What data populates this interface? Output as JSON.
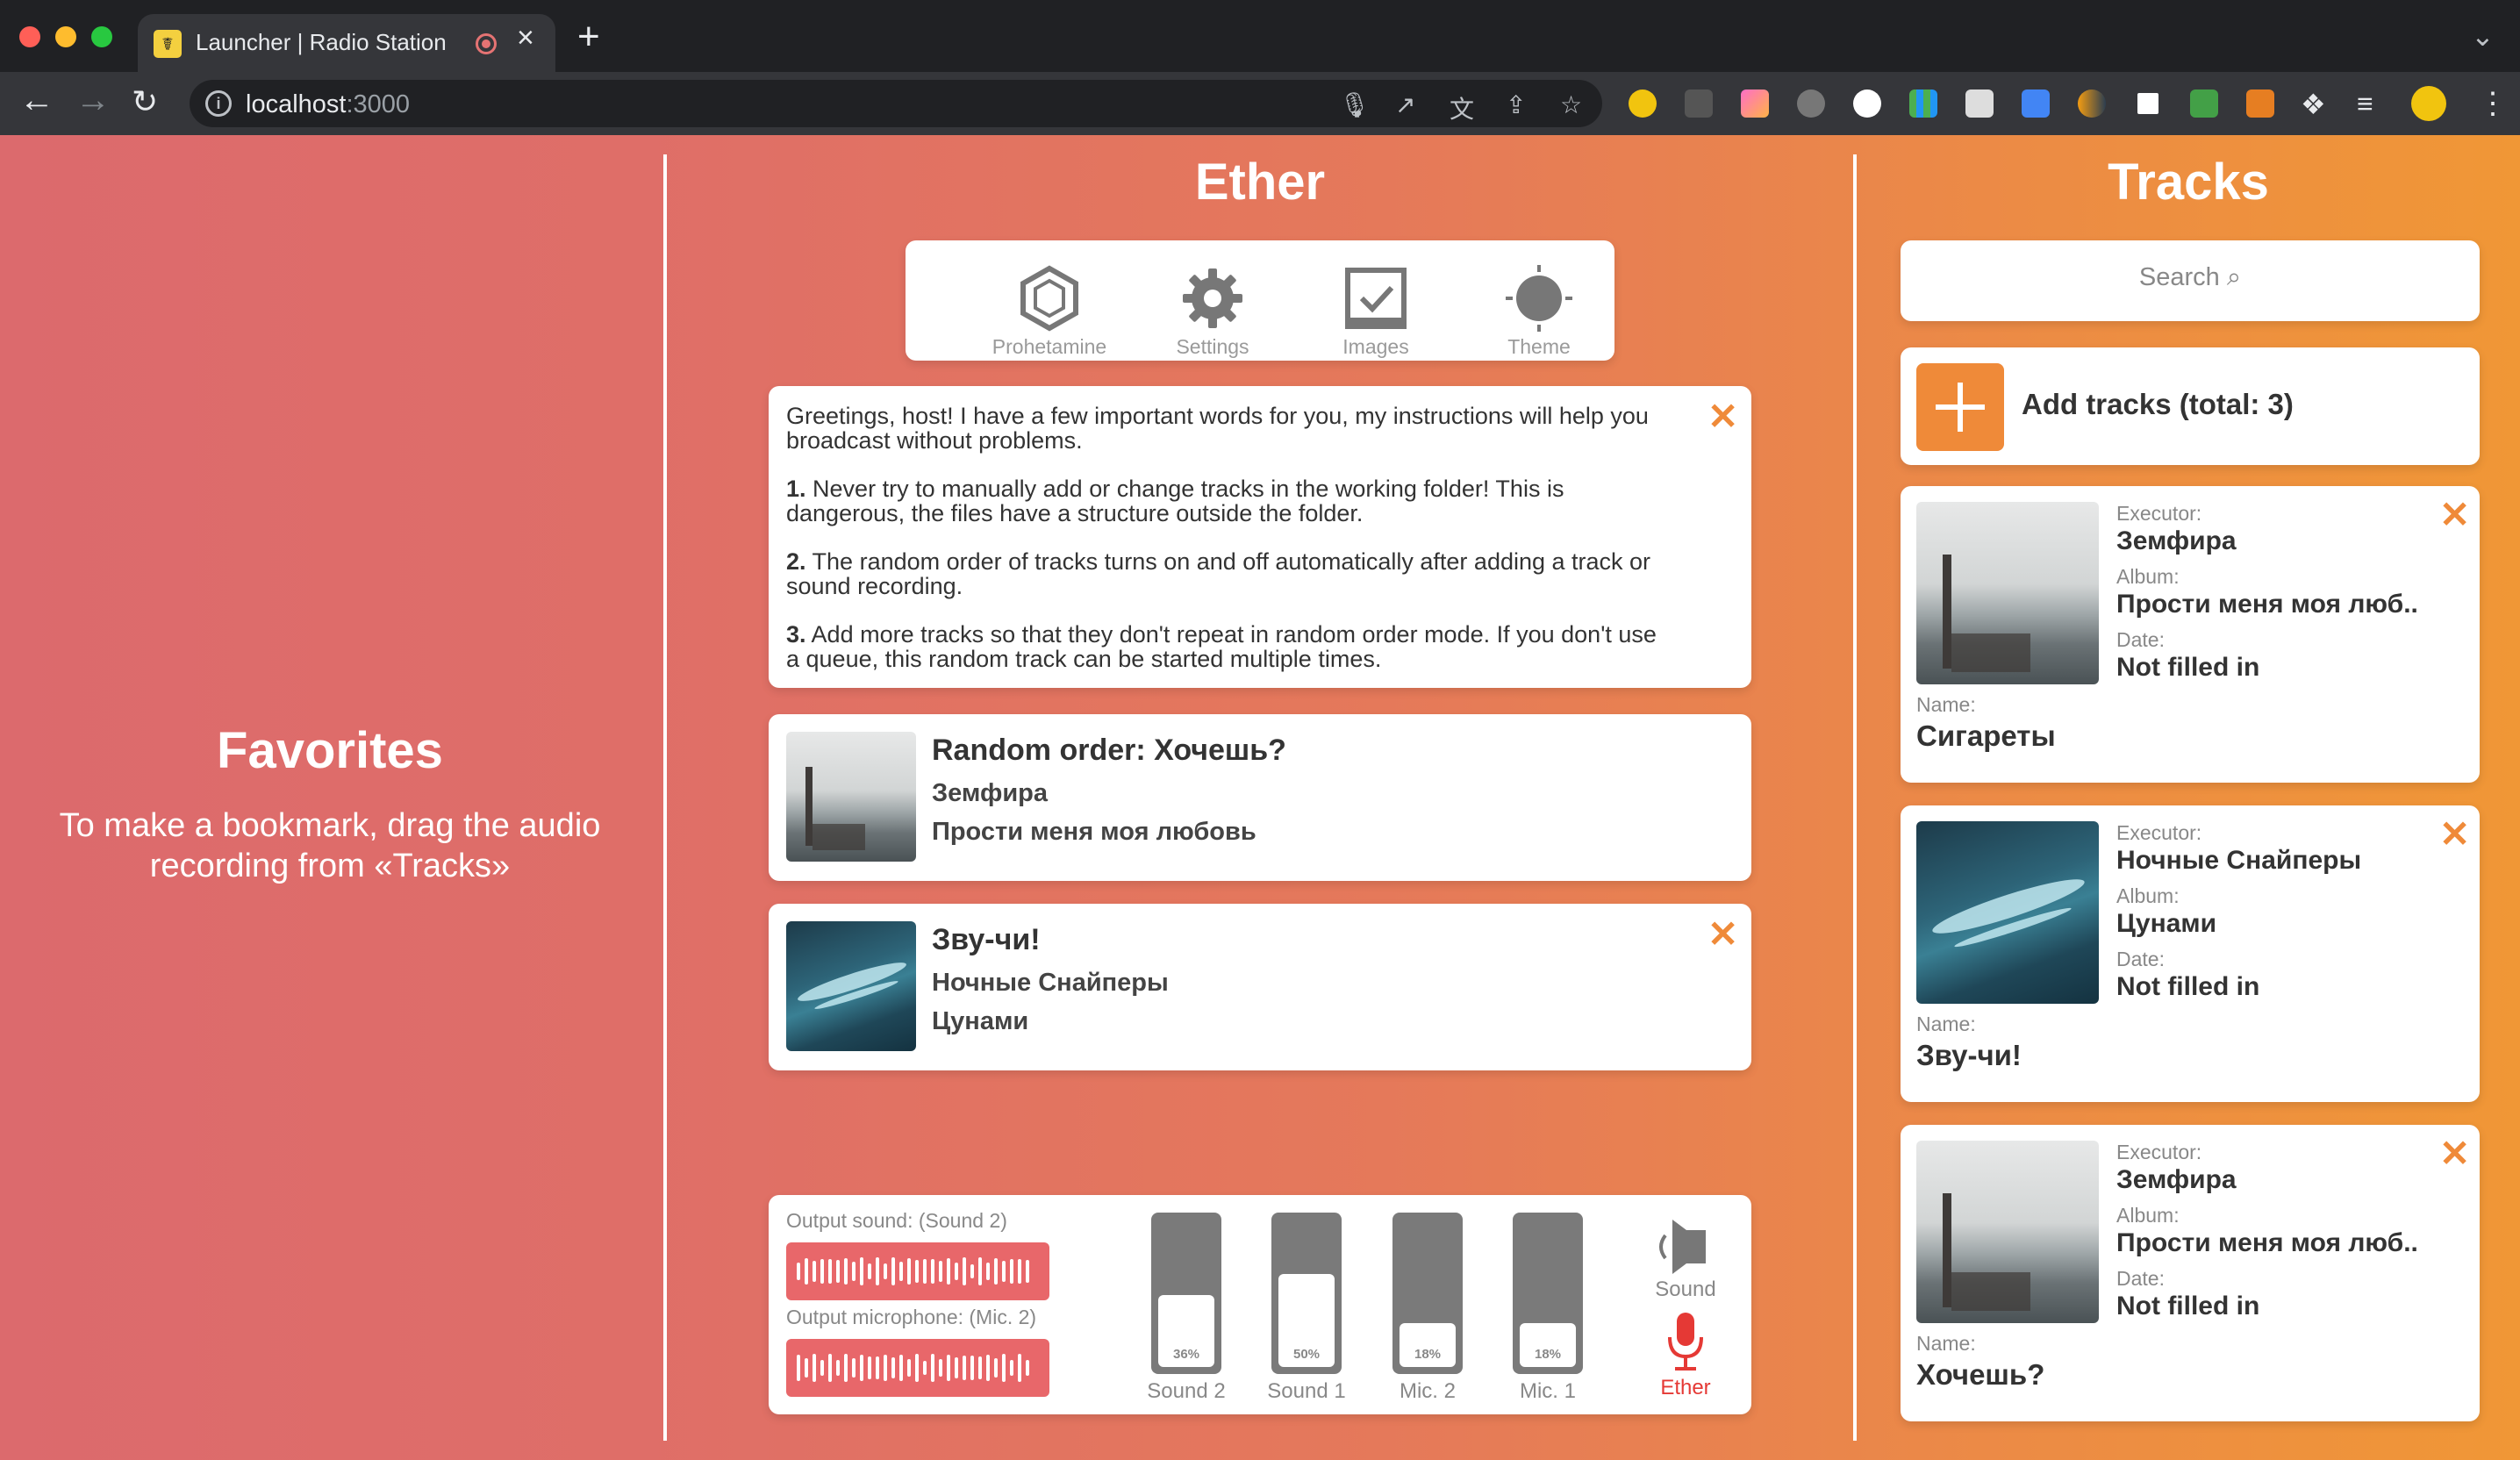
{
  "browser": {
    "tab_title": "Launcher | Radio Station",
    "tab_favicon": "radio-tower-icon",
    "url_host": "localhost",
    "url_port": ":3000"
  },
  "favorites": {
    "title": "Favorites",
    "text": "To make a bookmark, drag the audio recording from «Tracks»"
  },
  "ether": {
    "title": "Ether",
    "menu": [
      {
        "label": "Prohetamine",
        "icon": "hexagon-icon"
      },
      {
        "label": "Settings",
        "icon": "gear-icon"
      },
      {
        "label": "Images",
        "icon": "image-check-icon"
      },
      {
        "label": "Theme",
        "icon": "sun-icon"
      }
    ],
    "notice": {
      "intro": "Greetings, host! I have a few important words for you, my instructions will help you broadcast without problems.",
      "items": [
        {
          "num": "1.",
          "text": "Never try to manually add or change tracks in the working folder! This is dangerous, the files have a structure outside the folder."
        },
        {
          "num": "2.",
          "text": "The random order of tracks turns on and off automatically after adding a track or sound recording."
        },
        {
          "num": "3.",
          "text": "Add more tracks so that they don't repeat in random order mode. If you don't use a queue, this random track can be started multiple times."
        }
      ]
    },
    "queue": [
      {
        "title": "Random order: Хочешь?",
        "artist": "Земфира",
        "album": "Прости меня моя любовь",
        "closable": false
      },
      {
        "title": "Зву-чи!",
        "artist": "Ночные Снайперы",
        "album": "Цунами",
        "closable": true
      }
    ],
    "mixer": {
      "output_sound_label": "Output sound: (Sound 2)",
      "output_mic_label": "Output microphone: (Mic. 2)",
      "faders": [
        {
          "label": "Sound 2",
          "percent_text": "36%",
          "value": 36
        },
        {
          "label": "Sound 1",
          "percent_text": "50%",
          "value": 50
        },
        {
          "label": "Mic. 2",
          "percent_text": "18%",
          "value": 18
        },
        {
          "label": "Mic. 1",
          "percent_text": "18%",
          "value": 18
        }
      ],
      "sound_button": "Sound",
      "ether_button": "Ether",
      "ether_color": "#e53935"
    }
  },
  "tracks": {
    "title": "Tracks",
    "search_placeholder": "Search ⌕",
    "add_label": "Add tracks (total: 3)",
    "labels": {
      "executor": "Executor:",
      "album": "Album:",
      "date": "Date:",
      "name": "Name:"
    },
    "items": [
      {
        "executor": "Земфира",
        "album": "Прости меня моя люб..",
        "date": "Not filled in",
        "name": "Сигареты",
        "cover": "zemfira"
      },
      {
        "executor": "Ночные Снайперы",
        "album": "Цунами",
        "date": "Not filled in",
        "name": "Зву-чи!",
        "cover": "nochnye"
      },
      {
        "executor": "Земфира",
        "album": "Прости меня моя люб..",
        "date": "Not filled in",
        "name": "Хочешь?",
        "cover": "zemfira"
      }
    ]
  },
  "colors": {
    "accent": "#ef8a39",
    "page_left": "#dc6a6d",
    "page_right": "#f09736",
    "wave": "#e8676a"
  }
}
